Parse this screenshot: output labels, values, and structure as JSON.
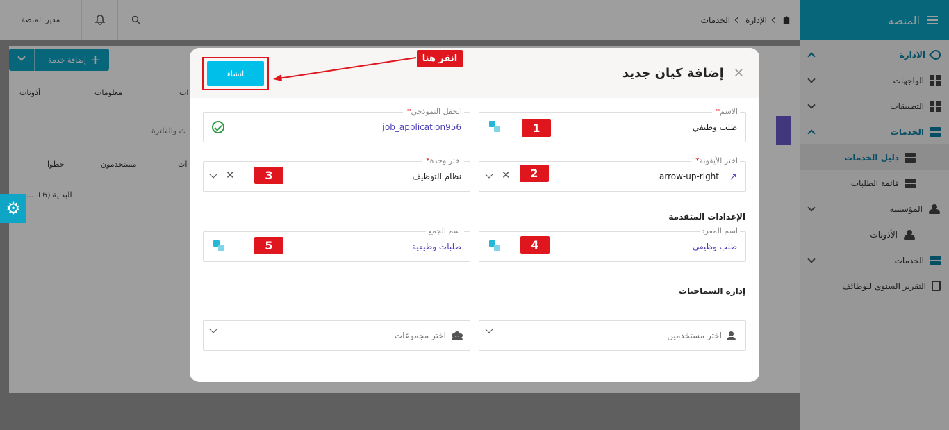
{
  "sidebar": {
    "title": "المنصة",
    "items": [
      {
        "label": "الادارة"
      },
      {
        "label": "الواجهات"
      },
      {
        "label": "التطبيقات"
      },
      {
        "label": "الخدمات"
      },
      {
        "label": "دليل الخدمات"
      },
      {
        "label": "قائمة الطلبات"
      },
      {
        "label": "المؤسسة"
      },
      {
        "label": "الأذونات"
      },
      {
        "label": "الخدمات"
      },
      {
        "label": "التقرير السنوي للوظائف"
      }
    ]
  },
  "topbar": {
    "crumbs": [
      "الإدارة",
      "الخدمات"
    ],
    "user": "مدير المنصة"
  },
  "background": {
    "add_button": "إضافة خدمة",
    "tabs": [
      "معلومات",
      "أذونات",
      "ات"
    ],
    "search_placeholder": "ث والفلترة",
    "cols": [
      "مستخدمون",
      "خطوا",
      "ات"
    ],
    "row_text": "البداية (6+ ..."
  },
  "modal": {
    "title": "إضافة كيان جديد",
    "create_label": "انشاء",
    "callout": "انقر هنا",
    "fields": {
      "name": {
        "label": "الاسم",
        "value": "طلب وظيفي",
        "badge": "1"
      },
      "model_field": {
        "label": "الحقل النموذجي",
        "value": "job_application956"
      },
      "icon": {
        "label": "اختر الأيقونة",
        "value": "arrow-up-right",
        "badge": "2"
      },
      "unit": {
        "label": "اختر وحدة",
        "value": "نظام التوظيف",
        "badge": "3"
      },
      "singular": {
        "label": "اسم المفرد",
        "value": "طلب وظيفي",
        "badge": "4"
      },
      "plural": {
        "label": "اسم الجمع",
        "value": "طلبات وظيفية",
        "badge": "5"
      },
      "users": {
        "placeholder": "اختر مستخدمين"
      },
      "groups": {
        "placeholder": "اختر مجموعات"
      }
    },
    "section_advanced": "الإعدادات المتقدمة",
    "section_permissions": "إدارة السماحيات"
  },
  "colors": {
    "accent": "#0ea5c6",
    "annotation": "#e0161e",
    "link": "#4a3fb5"
  }
}
